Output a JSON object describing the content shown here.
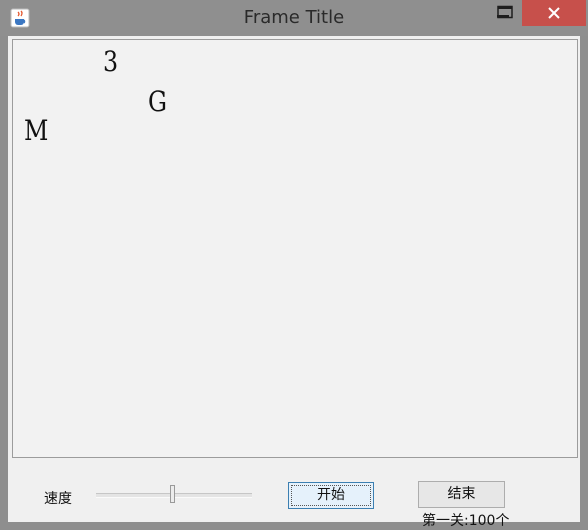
{
  "window": {
    "title": "Frame Title"
  },
  "titlebar_icons": {
    "app": "java-coffee-icon",
    "minimize": "minimize-icon",
    "maximize": "maximize-icon",
    "close": "close-icon"
  },
  "colors": {
    "close_button": "#c7504b",
    "titlebar": "#8f8f8f",
    "content_bg": "#f0f0f0"
  },
  "game": {
    "letters": [
      {
        "char": "3"
      },
      {
        "char": "G"
      },
      {
        "char": "M"
      }
    ]
  },
  "controls": {
    "speed_label": "速度",
    "speed_value": 0.49,
    "start_label": "开始",
    "end_label": "结束",
    "level_label": "第一关:100个"
  }
}
